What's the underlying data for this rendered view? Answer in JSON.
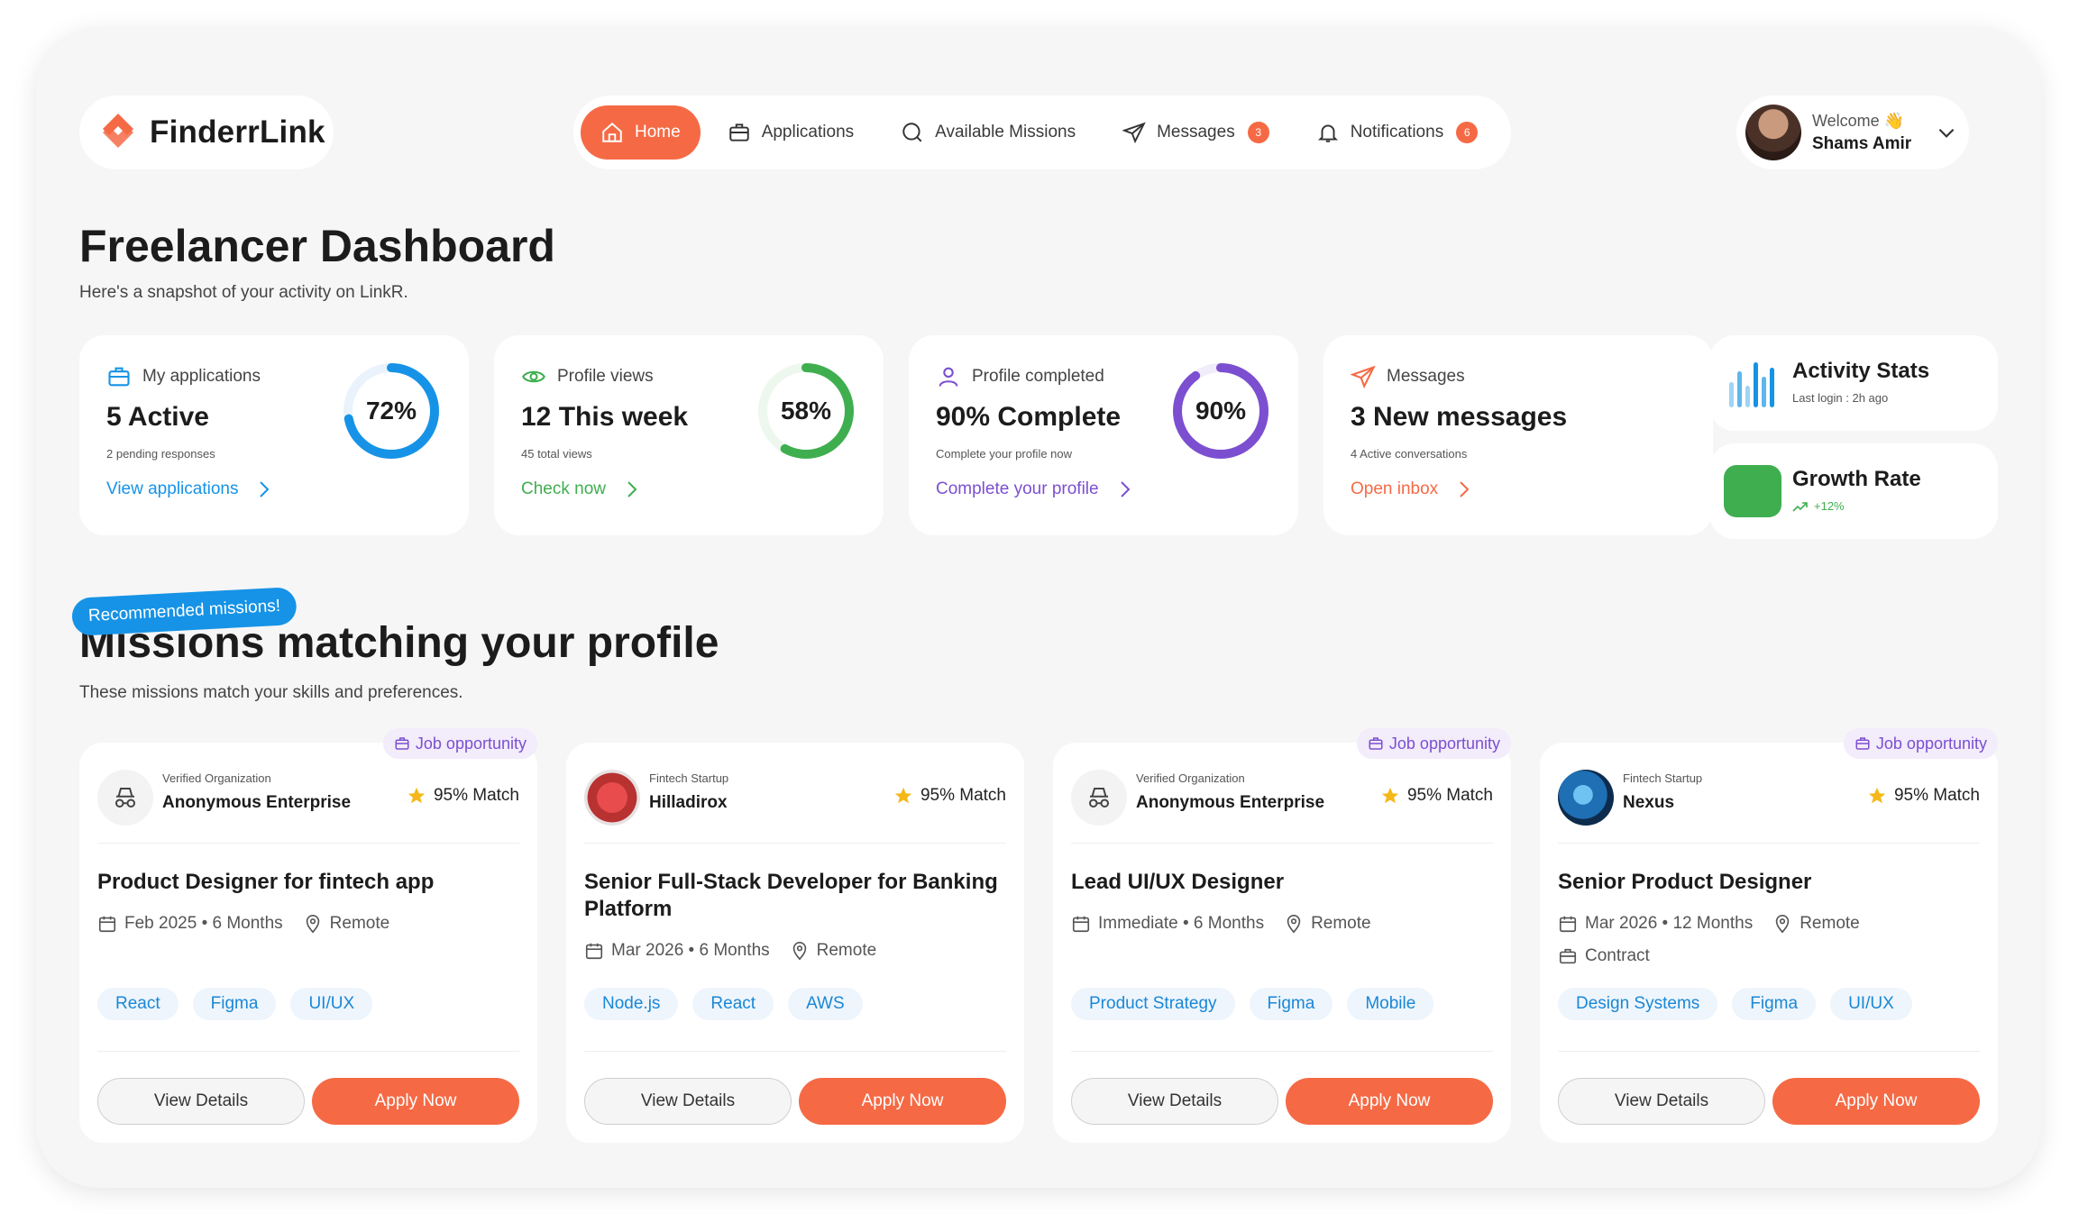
{
  "brand": {
    "name": "FinderrLink"
  },
  "nav": {
    "items": [
      {
        "label": "Home",
        "icon": "home-icon",
        "active": true
      },
      {
        "label": "Applications",
        "icon": "briefcase-icon"
      },
      {
        "label": "Available Missions",
        "icon": "search-icon"
      },
      {
        "label": "Messages",
        "icon": "send-icon",
        "badge": "3"
      },
      {
        "label": "Notifications",
        "icon": "bell-icon",
        "badge": "6"
      }
    ]
  },
  "user": {
    "welcome": "Welcome 👋",
    "name": "Shams Amir"
  },
  "page": {
    "title": "Freelancer Dashboard",
    "subtitle": "Here's a snapshot of your activity on LinkR."
  },
  "stats": [
    {
      "label": "My applications",
      "value": "5 Active",
      "small": "2 pending responses",
      "link": "View applications",
      "percent": 72,
      "percent_label": "72%",
      "color": "#1693e6"
    },
    {
      "label": "Profile views",
      "value": "12 This week",
      "small": "45 total views",
      "link": "Check now",
      "percent": 58,
      "percent_label": "58%",
      "color": "#3fae4f"
    },
    {
      "label": "Profile completed",
      "value": "90% Complete",
      "small": "Complete your profile now",
      "link": "Complete your profile",
      "percent": 90,
      "percent_label": "90%",
      "color": "#7c4fd0"
    },
    {
      "label": "Messages",
      "value": "3 New messages",
      "small": "4 Active conversations",
      "link": "Open inbox",
      "color": "#f56a45"
    }
  ],
  "activity": {
    "title": "Activity Stats",
    "subtitle": "Last login : 2h ago"
  },
  "growth": {
    "title": "Growth Rate",
    "value": "+12%"
  },
  "missions": {
    "tag": "Recommended missions!",
    "title": "Missions matching your profile",
    "subtitle": "These missions match your skills and preferences.",
    "job_tag": "Job opportunity",
    "view_label": "View Details",
    "apply_label": "Apply Now",
    "cards": [
      {
        "org_type": "Verified Organization",
        "org": "Anonymous Enterprise",
        "match": "95% Match",
        "title": "Product Designer for fintech app",
        "date": "Feb 2025 • 6 Months",
        "location": "Remote",
        "skills": [
          "React",
          "Figma",
          "UI/UX"
        ],
        "job_tag": true
      },
      {
        "org_type": "Fintech Startup",
        "org": "Hilladirox",
        "match": "95% Match",
        "title": "Senior Full-Stack Developer for Banking Platform",
        "date": "Mar 2026 • 6 Months",
        "location": "Remote",
        "skills": [
          "Node.js",
          "React",
          "AWS"
        ],
        "job_tag": false
      },
      {
        "org_type": "Verified Organization",
        "org": "Anonymous Enterprise",
        "match": "95% Match",
        "title": "Lead UI/UX Designer",
        "date": "Immediate • 6 Months",
        "location": "Remote",
        "skills": [
          "Product Strategy",
          "Figma",
          "Mobile"
        ],
        "job_tag": true
      },
      {
        "org_type": "Fintech Startup",
        "org": "Nexus",
        "match": "95% Match",
        "title": "Senior Product Designer",
        "date": "Mar 2026 • 12 Months",
        "location": "Remote",
        "contract": "Contract",
        "skills": [
          "Design Systems",
          "Figma",
          "UI/UX"
        ],
        "job_tag": true
      }
    ]
  },
  "colors": {
    "accent": "#f56a45",
    "blue": "#1693e6",
    "green": "#3fae4f",
    "purple": "#7c4fd0"
  }
}
